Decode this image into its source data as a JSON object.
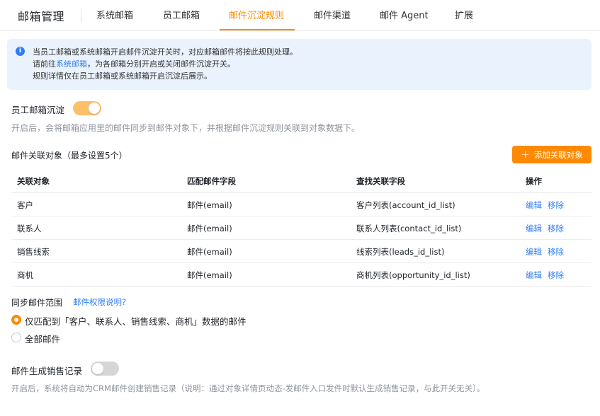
{
  "header": {
    "title": "邮箱管理",
    "tabs": [
      {
        "label": "系统邮箱",
        "active": false
      },
      {
        "label": "员工邮箱",
        "active": false
      },
      {
        "label": "邮件沉淀规则",
        "active": true
      },
      {
        "label": "邮件渠道",
        "active": false
      },
      {
        "label": "邮件 Agent",
        "active": false
      },
      {
        "label": "扩展",
        "active": false
      }
    ]
  },
  "banner": {
    "line1": "当员工邮箱或系统邮箱开启邮件沉淀开关时，对应邮箱邮件将按此规则处理。",
    "line2_prefix": "请前往",
    "line2_link": "系统邮箱",
    "line2_suffix": "，为各邮箱分别开启或关闭邮件沉淀开关。",
    "line3": "规则详情仅在员工邮箱或系统邮箱开启沉淀后展示。"
  },
  "employee_archive": {
    "label": "员工邮箱沉淀",
    "enabled": true,
    "hint": "开启后，会将邮箱应用里的邮件同步到邮件对象下，并根据邮件沉淀规则关联到对象数据下。"
  },
  "related_objects": {
    "title": "邮件关联对象（最多设置5个）",
    "add_button": "添加关联对象",
    "columns": [
      "关联对象",
      "匹配邮件字段",
      "查找关联字段",
      "操作"
    ],
    "rows": [
      {
        "object": "客户",
        "match_field": "邮件(email)",
        "lookup_field": "客户列表(account_id_list)"
      },
      {
        "object": "联系人",
        "match_field": "邮件(email)",
        "lookup_field": "联系人列表(contact_id_list)"
      },
      {
        "object": "销售线索",
        "match_field": "邮件(email)",
        "lookup_field": "线索列表(leads_id_list)"
      },
      {
        "object": "商机",
        "match_field": "邮件(email)",
        "lookup_field": "商机列表(opportunity_id_list)"
      }
    ],
    "edit_label": "编辑",
    "remove_label": "移除"
  },
  "sync_scope": {
    "label": "同步邮件范围",
    "perm_link": "邮件权限说明?",
    "options": [
      {
        "label": "仅匹配到「客户、联系人、销售线索、商机」数据的邮件",
        "checked": true
      },
      {
        "label": "全部邮件",
        "checked": false
      }
    ]
  },
  "sales_record": {
    "label": "邮件生成销售记录",
    "enabled": false,
    "hint": "开启后，系统将自动为CRM邮件创建销售记录（说明：通过对象详情页动态-发邮件入口发件时默认生成销售记录，与此开关无关）。"
  },
  "colors": {
    "accent": "#ff8a00",
    "toggle_on": "#fcc06b",
    "toggle_off": "#d6d6d6",
    "link": "#2f7cf6",
    "banner_bg": "#eaf3fd"
  }
}
